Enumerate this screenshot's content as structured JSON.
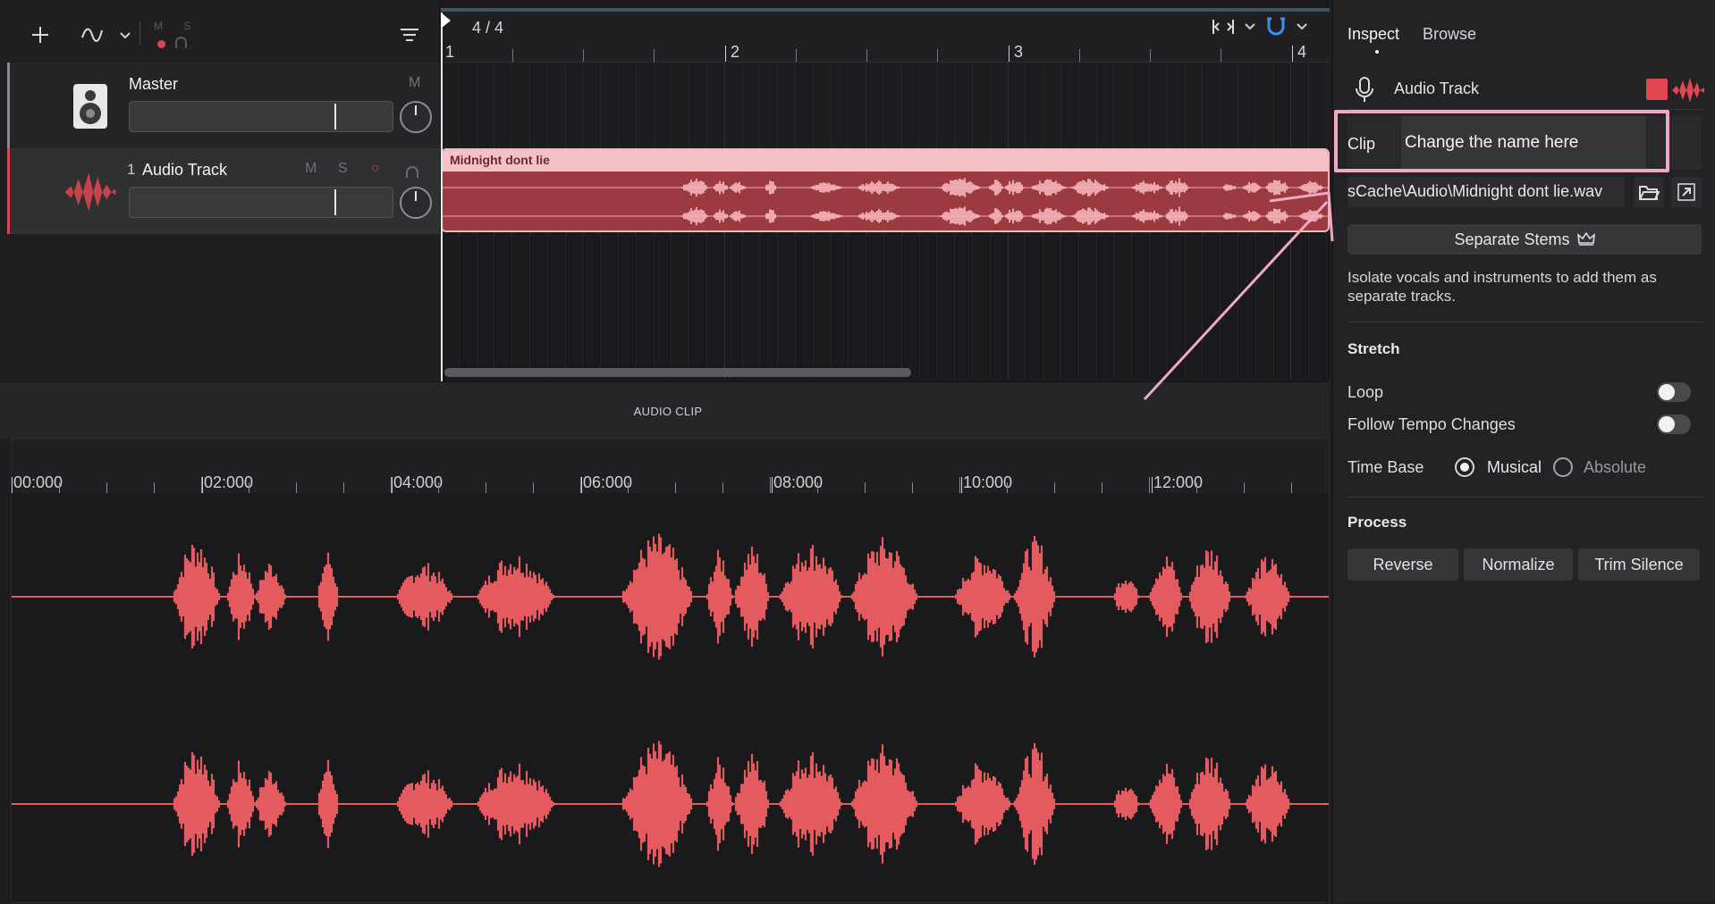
{
  "toolbar": {
    "add_icon": "plus-icon",
    "automation_icon": "curve-icon",
    "mini_ms_label": "M S",
    "menu_icon": "filter-lines-icon"
  },
  "tracks": [
    {
      "name": "Master",
      "number": "",
      "icon": "speaker-icon",
      "flags": [
        "M"
      ]
    },
    {
      "name": "Audio Track",
      "number": "1",
      "icon": "waveform-icon",
      "flags": [
        "M",
        "S",
        "○"
      ],
      "color": "#e0464f"
    }
  ],
  "ruler": {
    "time_signature": "4 / 4",
    "bars": [
      "1",
      "2",
      "3",
      "4"
    ]
  },
  "clip": {
    "title": "Midnight dont lie",
    "color": "#9c3a42"
  },
  "editor": {
    "title": "AUDIO CLIP",
    "times": [
      "00:000",
      "02:000",
      "04:000",
      "06:000",
      "08:000",
      "10:000",
      "12:000"
    ],
    "wave_color": "#e35b5e"
  },
  "inspector": {
    "tabs": [
      "Inspect",
      "Browse"
    ],
    "track_label": "Audio Track",
    "clip_label": "Clip",
    "clip_name": "Change the name here",
    "file_path": "sCache\\Audio\\Midnight dont lie.wav",
    "separate_stems": "Separate Stems",
    "description": "Isolate vocals and instruments to add them as separate tracks.",
    "stretch": {
      "title": "Stretch",
      "loop": "Loop",
      "follow_tempo": "Follow Tempo Changes",
      "time_base": "Time Base",
      "musical": "Musical",
      "absolute": "Absolute"
    },
    "process": {
      "title": "Process",
      "reverse": "Reverse",
      "normalize": "Normalize",
      "trim_silence": "Trim Silence"
    },
    "accent": "#e0464f",
    "annotation_color": "#f0a8c4"
  }
}
